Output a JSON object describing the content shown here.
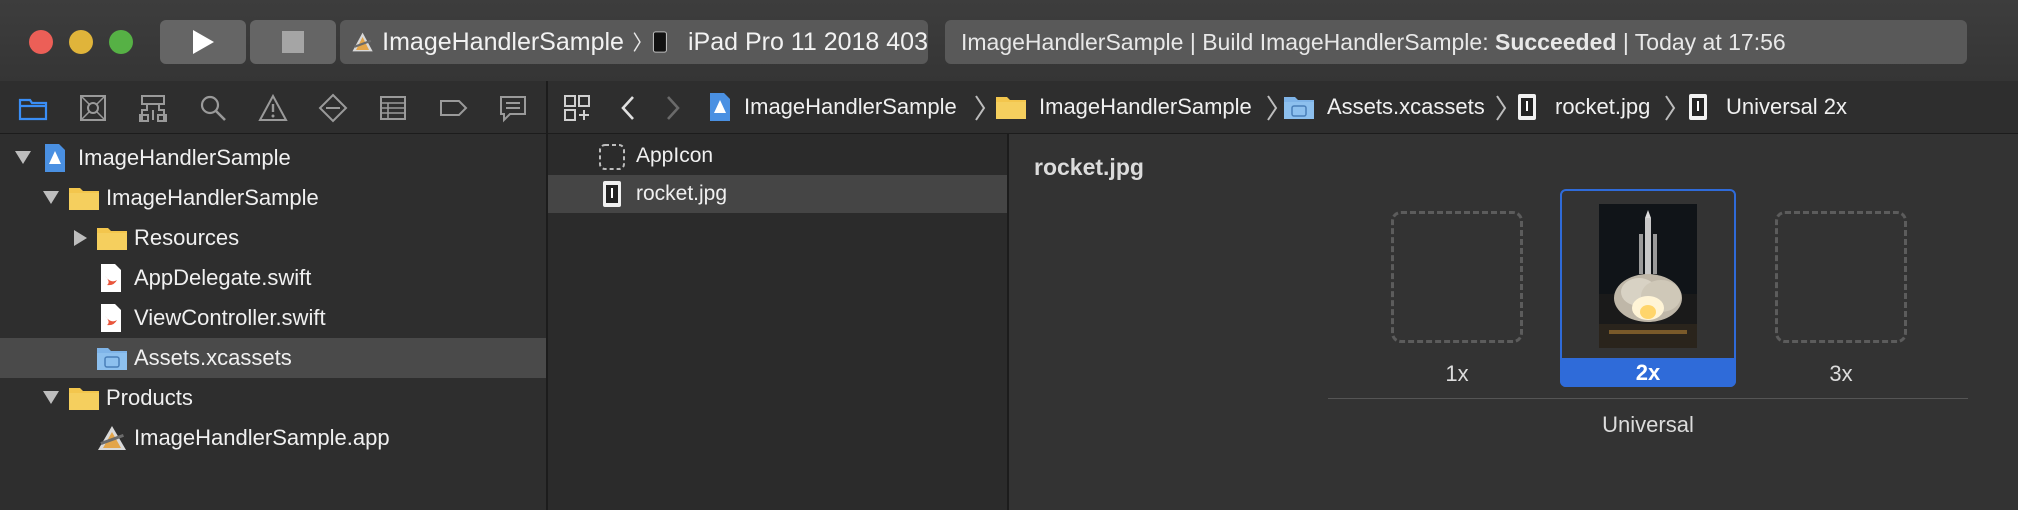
{
  "toolbar": {
    "scheme_name": "ImageHandlerSample",
    "device_name": "iPad Pro 11 2018 403",
    "activity": {
      "prefix": "ImageHandlerSample | Build ImageHandlerSample: ",
      "status": "Succeeded",
      "suffix": " | Today at 17:56"
    }
  },
  "navigator": {
    "tree": [
      {
        "label": "ImageHandlerSample",
        "icon": "project-icon"
      },
      {
        "label": "ImageHandlerSample",
        "icon": "folder-icon"
      },
      {
        "label": "Resources",
        "icon": "folder-icon"
      },
      {
        "label": "AppDelegate.swift",
        "icon": "swift-file-icon"
      },
      {
        "label": "ViewController.swift",
        "icon": "swift-file-icon"
      },
      {
        "label": "Assets.xcassets",
        "icon": "asset-catalog-icon"
      },
      {
        "label": "Products",
        "icon": "folder-icon"
      },
      {
        "label": "ImageHandlerSample.app",
        "icon": "app-icon"
      }
    ]
  },
  "jumpbar": {
    "crumbs": [
      "ImageHandlerSample",
      "ImageHandlerSample",
      "Assets.xcassets",
      "rocket.jpg",
      "Universal 2x"
    ]
  },
  "assets": {
    "items": [
      "AppIcon",
      "rocket.jpg"
    ]
  },
  "editor": {
    "title": "rocket.jpg",
    "slots": [
      "1x",
      "2x",
      "3x"
    ],
    "group_label": "Universal"
  },
  "colors": {
    "selection_blue": "#2f6bd9",
    "folder_yellow": "#f3c64d",
    "close_red": "#ec5f57",
    "minimize_yellow": "#e0b43a",
    "zoom_green": "#56b145"
  }
}
